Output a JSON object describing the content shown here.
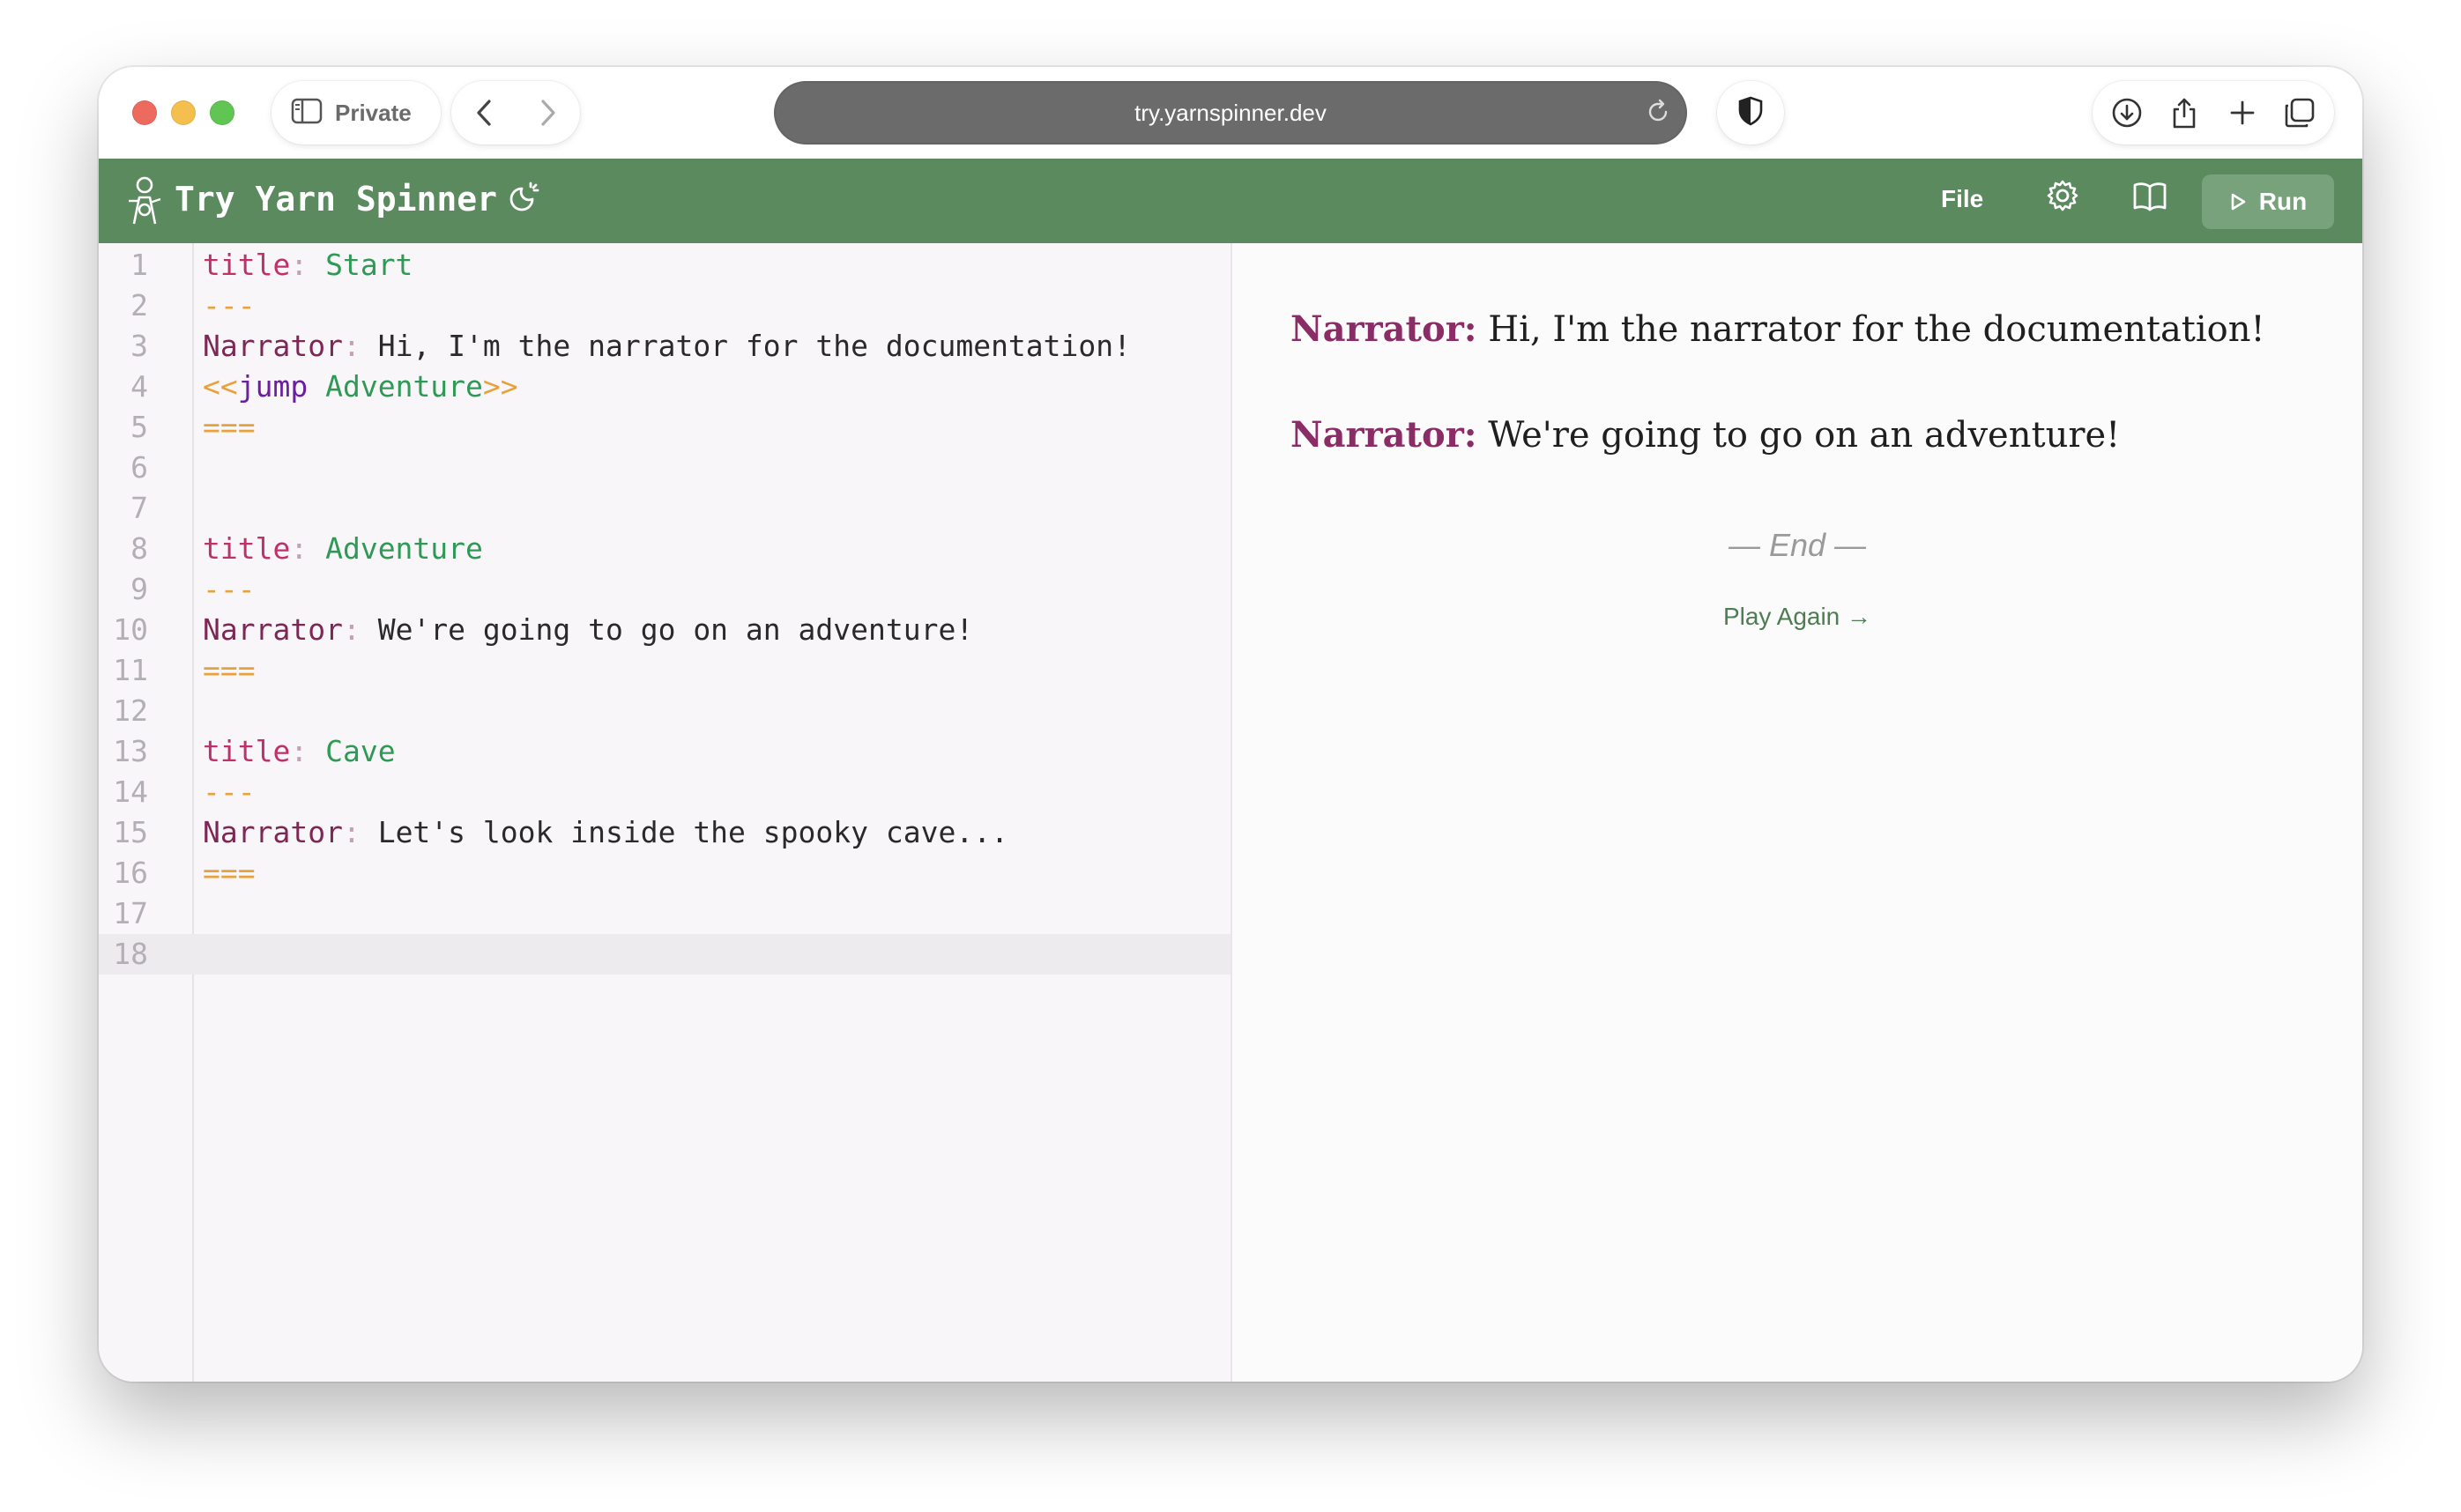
{
  "browser": {
    "private_label": "Private",
    "url": "try.yarnspinner.dev"
  },
  "app": {
    "title": "Try Yarn Spinner",
    "file_label": "File",
    "run_label": "Run",
    "brand_color": "#5b8a5f"
  },
  "editor": {
    "line_numbers": [
      "1",
      "2",
      "3",
      "4",
      "5",
      "6",
      "7",
      "8",
      "9",
      "10",
      "11",
      "12",
      "13",
      "14",
      "15",
      "16",
      "17",
      "18"
    ],
    "active_line": "18",
    "lines": [
      {
        "key": "title",
        "colon": ":",
        "value": " Start"
      },
      {
        "sep": "---"
      },
      {
        "char": "Narrator",
        "colon": ":",
        "text": " Hi, I'm the narrator for the documentation!"
      },
      {
        "open": "<<",
        "cmd": "jump",
        "arg": " Adventure",
        "close": ">>"
      },
      {
        "sep": "==="
      },
      {},
      {},
      {
        "key": "title",
        "colon": ":",
        "value": " Adventure"
      },
      {
        "sep": "---"
      },
      {
        "char": "Narrator",
        "colon": ":",
        "text": " We're going to go on an adventure!"
      },
      {
        "sep": "==="
      },
      {},
      {
        "key": "title",
        "colon": ":",
        "value": " Cave"
      },
      {
        "sep": "---"
      },
      {
        "char": "Narrator",
        "colon": ":",
        "text": " Let's look inside the spooky cave..."
      },
      {
        "sep": "==="
      },
      {},
      {}
    ]
  },
  "preview": {
    "dialogue": [
      {
        "speaker": "Narrator:",
        "text": " Hi, I'm the narrator for the documentation!"
      },
      {
        "speaker": "Narrator:",
        "text": " We're going to go on an adventure!"
      }
    ],
    "end_label": "— End —",
    "play_again_label": "Play Again →"
  }
}
